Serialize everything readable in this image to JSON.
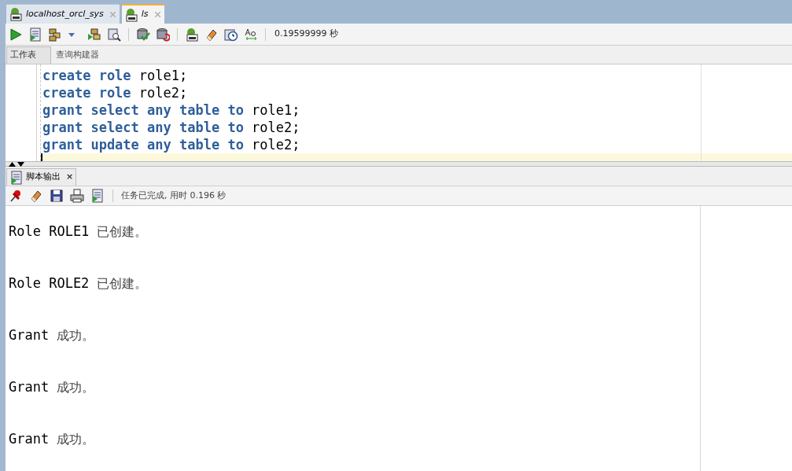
{
  "doc_tabs": [
    {
      "label": "localhost_orcl_sys",
      "selected": false
    },
    {
      "label": "ls",
      "selected": true
    }
  ],
  "toolbar": {
    "elapsed": "0.19599999 秒"
  },
  "editor_tabs": [
    {
      "label": "工作表",
      "selected": true
    },
    {
      "label": "查询构建器",
      "selected": false
    }
  ],
  "code_lines": [
    [
      {
        "text": "create role",
        "kind": "keyword"
      },
      {
        "text": " role1;",
        "kind": "plain"
      }
    ],
    [
      {
        "text": "create role",
        "kind": "keyword"
      },
      {
        "text": " role2;",
        "kind": "plain"
      }
    ],
    [
      {
        "text": "grant select any table to",
        "kind": "keyword"
      },
      {
        "text": " role1;",
        "kind": "plain"
      }
    ],
    [
      {
        "text": "grant select any table to",
        "kind": "keyword"
      },
      {
        "text": " role2;",
        "kind": "plain"
      }
    ],
    [
      {
        "text": "grant update any table to",
        "kind": "keyword"
      },
      {
        "text": " role2;",
        "kind": "plain"
      }
    ]
  ],
  "output_panel": {
    "tab": "脚本输出",
    "close": "×",
    "status": "任务已完成, 用时 0.196 秒"
  },
  "output_lines": [
    {
      "subject": "Role ROLE1",
      "message": "已创建。"
    },
    {
      "subject": "Role ROLE2",
      "message": "已创建。"
    },
    {
      "subject": "Grant",
      "message": "成功。"
    },
    {
      "subject": "Grant",
      "message": "成功。"
    },
    {
      "subject": "Grant",
      "message": "成功。"
    }
  ]
}
